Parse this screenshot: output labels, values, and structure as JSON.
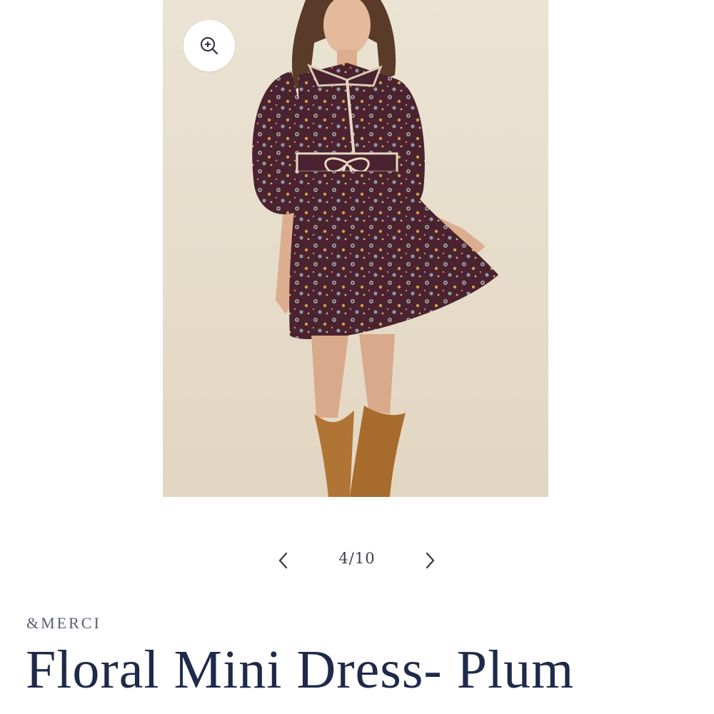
{
  "gallery": {
    "image_alt": "Model wearing a plum floral mini dress with tie waist and tan cowboy boots",
    "zoom_icon": "zoom-in-icon",
    "prev_icon": "chevron-left-icon",
    "next_icon": "chevron-right-icon",
    "counter": "4/10",
    "current_index": 4,
    "total": 10
  },
  "product": {
    "vendor": "&MERCI",
    "title": "Floral Mini Dress- Plum"
  },
  "colors": {
    "title": "#1f2a4a",
    "vendor": "#5a5f6b",
    "dress_plum": "#4a2230",
    "boots_tan": "#b07434",
    "backdrop": "#e8e0cf"
  }
}
